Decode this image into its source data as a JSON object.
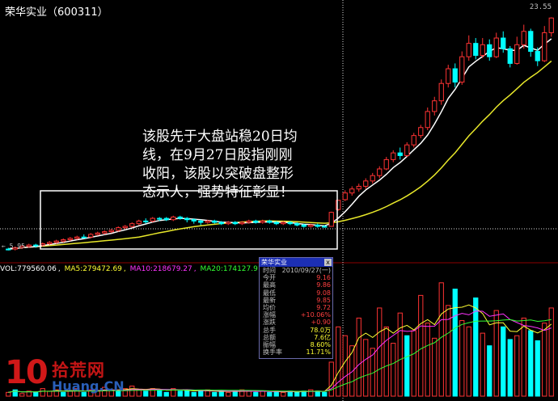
{
  "title": {
    "name": "荣华实业",
    "code": "600311"
  },
  "price_top_label": "23.55",
  "price_low_label": "5.95",
  "annotation": "该股先于大盘站稳20日均\n线，在9月27日股指刚刚\n收阳，该股以突破盘整形\n态示人，强势特征彰显！",
  "volume_legend": [
    {
      "label": "VOL:779560.06",
      "color": "#ffffff"
    },
    {
      "label": "MA5:279472.69",
      "color": "#ffff33"
    },
    {
      "label": "MA10:218679.27",
      "color": "#ff33ff"
    },
    {
      "label": "MA20:174127.91",
      "color": "#33ff33"
    }
  ],
  "infobox": {
    "title": "荣华实业",
    "close_symbol": "x",
    "rows": [
      {
        "label": "时间",
        "value": "2010/09/27(一)",
        "color": "#c0c0c0"
      },
      {
        "label": "今开",
        "value": "9.16",
        "color": "#ff4040"
      },
      {
        "label": "最高",
        "value": "9.86",
        "color": "#ff4040"
      },
      {
        "label": "最低",
        "value": "9.08",
        "color": "#ff4040"
      },
      {
        "label": "最新",
        "value": "9.85",
        "color": "#ff4040"
      },
      {
        "label": "均价",
        "value": "9.72",
        "color": "#ff4040"
      },
      {
        "label": "涨幅",
        "value": "+10.06%",
        "color": "#ff4040"
      },
      {
        "label": "涨跌",
        "value": "+0.90",
        "color": "#ff4040"
      },
      {
        "label": "总手",
        "value": "78.0万",
        "color": "#ffff33"
      },
      {
        "label": "总额",
        "value": "7.6亿",
        "color": "#ffff33"
      },
      {
        "label": "振幅",
        "value": "8.60%",
        "color": "#ffff33"
      },
      {
        "label": "换手率",
        "value": "11.71%",
        "color": "#ffff33"
      }
    ]
  },
  "logo": {
    "number": "10",
    "cn_text": "拾荒网",
    "en_text": "Huang.CN"
  },
  "colors": {
    "up": "#ff3333",
    "down": "#00ffff",
    "ma20": "#e8e82a",
    "ma_white": "#ffffff",
    "vol_ma5": "#ffff33",
    "vol_ma10": "#ff33ff",
    "vol_ma20": "#33ff33"
  },
  "chart_data": {
    "type": "candlestick",
    "price_axis_labels": {
      "top": "23.55",
      "low": "5.95"
    },
    "candles": [
      [
        6.2,
        6.2,
        6.1,
        6.3,
        0
      ],
      [
        6.2,
        6.3,
        6.1,
        6.4,
        1
      ],
      [
        6.3,
        6.4,
        6.2,
        6.5,
        1
      ],
      [
        6.4,
        6.5,
        6.3,
        6.6,
        1
      ],
      [
        6.5,
        6.5,
        6.3,
        6.6,
        0
      ],
      [
        6.5,
        6.6,
        6.4,
        6.7,
        1
      ],
      [
        6.6,
        6.7,
        6.5,
        6.8,
        1
      ],
      [
        6.7,
        6.8,
        6.6,
        6.9,
        1
      ],
      [
        6.8,
        6.9,
        6.7,
        7.0,
        1
      ],
      [
        6.9,
        7.0,
        6.8,
        7.1,
        1
      ],
      [
        7.0,
        7.1,
        6.9,
        7.2,
        1
      ],
      [
        7.1,
        7.1,
        7.0,
        7.3,
        0
      ],
      [
        7.1,
        7.3,
        7.0,
        7.4,
        1
      ],
      [
        7.3,
        7.4,
        7.2,
        7.5,
        1
      ],
      [
        7.4,
        7.5,
        7.3,
        7.6,
        1
      ],
      [
        7.5,
        7.6,
        7.4,
        7.7,
        1
      ],
      [
        7.6,
        7.8,
        7.5,
        7.9,
        1
      ],
      [
        7.8,
        7.9,
        7.7,
        8.0,
        1
      ],
      [
        7.9,
        8.1,
        7.8,
        8.2,
        1
      ],
      [
        8.1,
        8.3,
        8.0,
        8.4,
        1
      ],
      [
        8.3,
        8.3,
        8.1,
        8.5,
        0
      ],
      [
        8.3,
        8.5,
        8.2,
        8.6,
        1
      ],
      [
        8.5,
        8.5,
        8.3,
        8.6,
        0
      ],
      [
        8.5,
        8.4,
        8.3,
        8.6,
        0
      ],
      [
        8.4,
        8.6,
        8.3,
        8.7,
        1
      ],
      [
        8.6,
        8.5,
        8.4,
        8.7,
        0
      ],
      [
        8.5,
        8.4,
        8.2,
        8.6,
        0
      ],
      [
        8.4,
        8.3,
        8.1,
        8.5,
        0
      ],
      [
        8.3,
        8.2,
        8.0,
        8.4,
        0
      ],
      [
        8.2,
        8.3,
        8.1,
        8.4,
        1
      ],
      [
        8.3,
        8.2,
        8.1,
        8.4,
        0
      ],
      [
        8.2,
        8.1,
        8.0,
        8.3,
        0
      ],
      [
        8.1,
        8.2,
        8.0,
        8.3,
        1
      ],
      [
        8.2,
        8.1,
        8.0,
        8.3,
        0
      ],
      [
        8.1,
        8.2,
        8.0,
        8.3,
        1
      ],
      [
        8.2,
        8.3,
        8.1,
        8.4,
        1
      ],
      [
        8.3,
        8.2,
        8.1,
        8.4,
        0
      ],
      [
        8.2,
        8.3,
        8.1,
        8.4,
        1
      ],
      [
        8.3,
        8.2,
        8.1,
        8.4,
        0
      ],
      [
        8.2,
        8.1,
        8.0,
        8.3,
        0
      ],
      [
        8.1,
        8.2,
        8.0,
        8.3,
        1
      ],
      [
        8.2,
        8.1,
        8.0,
        8.3,
        0
      ],
      [
        8.1,
        8.0,
        7.9,
        8.2,
        0
      ],
      [
        8.0,
        7.9,
        7.8,
        8.1,
        0
      ],
      [
        7.9,
        8.0,
        7.8,
        8.1,
        1
      ],
      [
        8.0,
        7.9,
        7.8,
        8.1,
        0
      ],
      [
        7.9,
        7.9,
        7.8,
        8.0,
        0
      ],
      [
        7.9,
        8.95,
        7.9,
        9.0,
        1
      ],
      [
        9.16,
        9.85,
        9.08,
        9.86,
        1
      ],
      [
        9.9,
        10.4,
        9.8,
        10.6,
        1
      ],
      [
        10.4,
        10.7,
        10.2,
        10.9,
        1
      ],
      [
        10.7,
        10.9,
        10.5,
        11.1,
        1
      ],
      [
        10.9,
        11.3,
        10.7,
        11.5,
        1
      ],
      [
        11.3,
        11.7,
        11.1,
        11.9,
        1
      ],
      [
        11.7,
        12.2,
        11.5,
        12.4,
        1
      ],
      [
        12.2,
        12.9,
        12.1,
        13.1,
        1
      ],
      [
        12.9,
        13.4,
        12.7,
        13.6,
        1
      ],
      [
        13.4,
        13.2,
        12.9,
        13.8,
        0
      ],
      [
        13.2,
        14.0,
        13.1,
        14.2,
        1
      ],
      [
        14.0,
        14.7,
        13.8,
        14.9,
        1
      ],
      [
        14.7,
        15.3,
        14.5,
        15.5,
        1
      ],
      [
        15.3,
        16.5,
        15.1,
        16.8,
        1
      ],
      [
        16.5,
        17.3,
        16.2,
        17.6,
        1
      ],
      [
        17.3,
        18.6,
        17.0,
        18.9,
        1
      ],
      [
        18.6,
        19.7,
        18.3,
        20.0,
        1
      ],
      [
        19.7,
        18.7,
        18.3,
        20.1,
        0
      ],
      [
        18.7,
        20.6,
        18.5,
        21.0,
        1
      ],
      [
        20.6,
        21.6,
        20.3,
        22.2,
        1
      ],
      [
        21.6,
        20.7,
        20.4,
        22.0,
        0
      ],
      [
        20.7,
        21.5,
        20.5,
        22.0,
        1
      ],
      [
        21.5,
        20.6,
        20.3,
        21.9,
        0
      ],
      [
        20.6,
        22.0,
        20.5,
        22.4,
        1
      ],
      [
        22.0,
        21.2,
        20.9,
        22.5,
        0
      ],
      [
        21.2,
        20.1,
        19.8,
        21.4,
        0
      ],
      [
        20.1,
        21.5,
        20.0,
        22.1,
        1
      ],
      [
        21.5,
        22.5,
        21.2,
        23.0,
        1
      ],
      [
        22.5,
        21.0,
        20.6,
        22.7,
        0
      ],
      [
        21.0,
        20.3,
        19.9,
        21.3,
        0
      ],
      [
        20.3,
        22.4,
        20.2,
        22.9,
        1
      ],
      [
        22.4,
        23.5,
        22.1,
        23.55,
        1
      ]
    ],
    "volumes": [
      [
        3,
        1
      ],
      [
        5,
        0
      ],
      [
        2,
        1
      ],
      [
        4,
        1
      ],
      [
        3,
        0
      ],
      [
        6,
        1
      ],
      [
        4,
        1
      ],
      [
        5,
        1
      ],
      [
        3,
        0
      ],
      [
        4,
        1
      ],
      [
        6,
        1
      ],
      [
        3,
        0
      ],
      [
        5,
        1
      ],
      [
        4,
        1
      ],
      [
        7,
        1
      ],
      [
        5,
        1
      ],
      [
        4,
        0
      ],
      [
        6,
        1
      ],
      [
        8,
        1
      ],
      [
        5,
        1
      ],
      [
        4,
        0
      ],
      [
        6,
        1
      ],
      [
        5,
        0
      ],
      [
        3,
        0
      ],
      [
        6,
        1
      ],
      [
        4,
        0
      ],
      [
        5,
        0
      ],
      [
        3,
        0
      ],
      [
        4,
        0
      ],
      [
        5,
        1
      ],
      [
        3,
        0
      ],
      [
        4,
        0
      ],
      [
        3,
        1
      ],
      [
        4,
        0
      ],
      [
        5,
        1
      ],
      [
        4,
        1
      ],
      [
        3,
        0
      ],
      [
        4,
        1
      ],
      [
        3,
        0
      ],
      [
        4,
        0
      ],
      [
        3,
        1
      ],
      [
        4,
        0
      ],
      [
        3,
        0
      ],
      [
        4,
        0
      ],
      [
        5,
        1
      ],
      [
        4,
        0
      ],
      [
        3,
        0
      ],
      [
        27,
        1
      ],
      [
        55,
        1
      ],
      [
        48,
        1
      ],
      [
        40,
        1
      ],
      [
        62,
        1
      ],
      [
        45,
        1
      ],
      [
        38,
        1
      ],
      [
        70,
        1
      ],
      [
        55,
        1
      ],
      [
        42,
        1
      ],
      [
        66,
        1
      ],
      [
        48,
        0
      ],
      [
        52,
        1
      ],
      [
        80,
        1
      ],
      [
        58,
        1
      ],
      [
        46,
        1
      ],
      [
        90,
        1
      ],
      [
        72,
        1
      ],
      [
        85,
        0
      ],
      [
        60,
        1
      ],
      [
        55,
        1
      ],
      [
        78,
        0
      ],
      [
        50,
        1
      ],
      [
        40,
        0
      ],
      [
        68,
        1
      ],
      [
        55,
        0
      ],
      [
        45,
        0
      ],
      [
        48,
        1
      ],
      [
        62,
        1
      ],
      [
        52,
        0
      ],
      [
        44,
        0
      ],
      [
        58,
        1
      ],
      [
        70,
        1
      ]
    ]
  }
}
